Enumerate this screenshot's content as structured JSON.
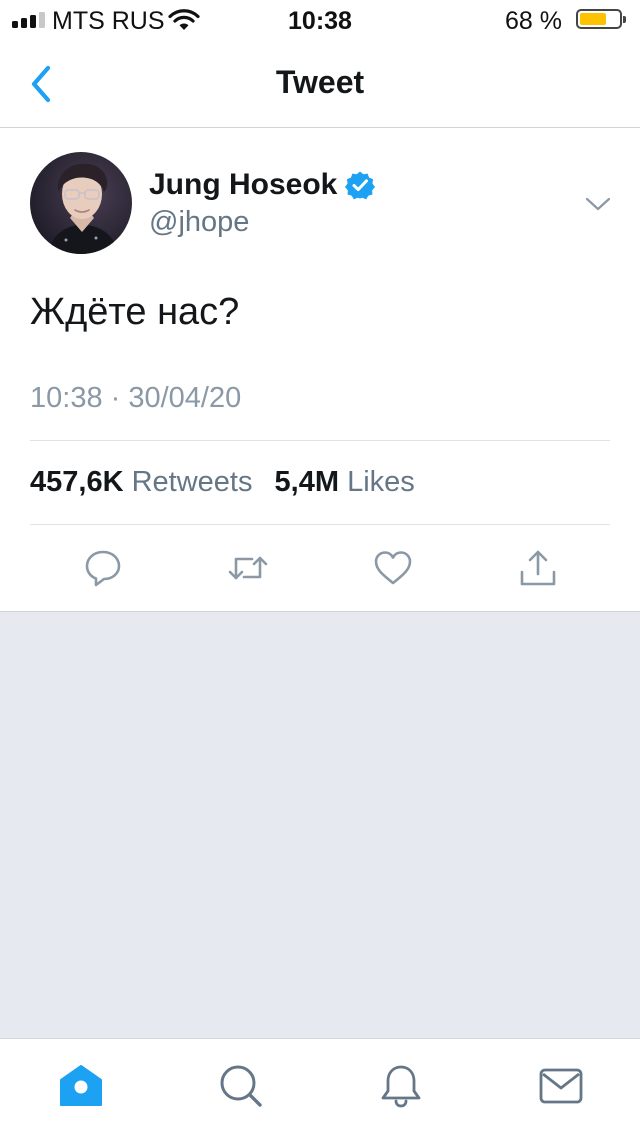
{
  "status_bar": {
    "carrier": "MTS RUS",
    "time": "10:38",
    "battery_percent": "68 %",
    "battery_level": 0.68,
    "signal_bars": 3,
    "icons": [
      "signal-icon",
      "wifi-icon",
      "battery-icon"
    ]
  },
  "nav": {
    "title": "Tweet",
    "back_icon": "chevron-left-icon"
  },
  "tweet": {
    "author_name": "Jung Hoseok",
    "handle": "@jhope",
    "verified": true,
    "text": "Ждёте нас?",
    "timestamp": "10:38 · 30/04/20",
    "retweets_count": "457,6K",
    "retweets_label": "Retweets",
    "likes_count": "5,4M",
    "likes_label": "Likes",
    "actions": [
      "reply-icon",
      "retweet-icon",
      "like-icon",
      "share-icon"
    ]
  },
  "tab_bar": {
    "items": [
      "home-icon",
      "search-icon",
      "notifications-icon",
      "messages-icon"
    ],
    "active": "home-icon"
  },
  "colors": {
    "accent": "#1da1f2",
    "text_primary": "#14171a",
    "text_secondary": "#657786",
    "background": "#e6e9f0",
    "battery_fill": "#ffc200"
  }
}
